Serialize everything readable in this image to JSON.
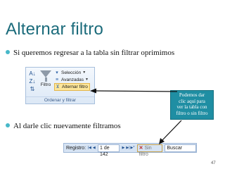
{
  "slide": {
    "title": "Alternar filtro",
    "bullets": [
      "Si queremos regresar a la tabla sin filtrar oprimimos",
      "Al darle clic nuevamente filtramos"
    ],
    "page_number": "47"
  },
  "ribbon": {
    "filter_button_label": "Filtro",
    "commands": [
      "Selección",
      "Avanzadas",
      "Alternar filtro"
    ],
    "group_label": "Ordenar y filtrar"
  },
  "callout": {
    "lines": [
      "Podemos dar",
      "clic aquí para",
      "ver la tabla  con",
      "filtro o sin filtro"
    ]
  },
  "navbar": {
    "records_label": "Registro:",
    "current_record": "1 de 142",
    "no_filter_label": "Sin filtro",
    "search_placeholder": "Buscar"
  },
  "colors": {
    "title": "#1b6b7b",
    "bullet": "#47b8c9",
    "callout": "#1f8ea3",
    "arrow": "#111111"
  },
  "icons": [
    "sort-ascending-icon",
    "sort-descending-icon",
    "clear-sort-icon",
    "funnel-icon",
    "selection-icon",
    "advanced-filter-icon",
    "toggle-filter-icon",
    "first-record-icon",
    "previous-record-icon",
    "next-record-icon",
    "last-record-icon",
    "new-record-icon"
  ]
}
